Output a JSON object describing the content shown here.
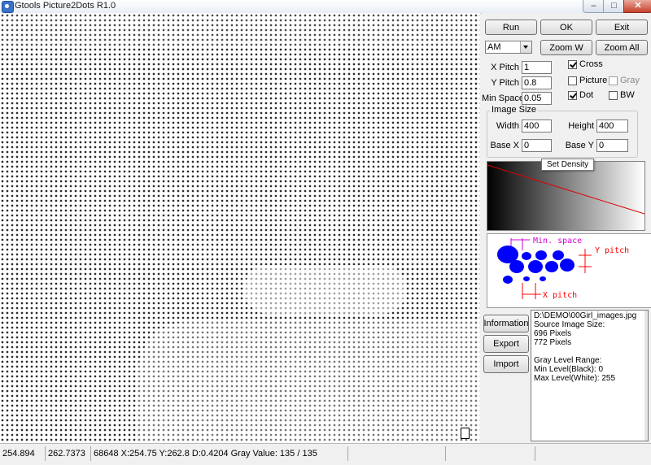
{
  "window": {
    "title": "Gtools Picture2Dots R1.0",
    "min_glyph": "–",
    "max_glyph": "□",
    "close_glyph": "✕"
  },
  "toolbar": {
    "run_label": "Run",
    "ok_label": "OK",
    "exit_label": "Exit",
    "mode_value": "AM",
    "zoom_w_label": "Zoom W",
    "zoom_all_label": "Zoom All"
  },
  "params": {
    "x_pitch_label": "X Pitch",
    "x_pitch_value": "1",
    "y_pitch_label": "Y Pitch",
    "y_pitch_value": "0.8",
    "min_space_label": "Min Space",
    "min_space_value": "0.05"
  },
  "options": {
    "cross_label": "Cross",
    "cross_checked": true,
    "picture_label": "Picture",
    "picture_checked": false,
    "gray_label": "Gray",
    "gray_checked": false,
    "dot_label": "Dot",
    "dot_checked": true,
    "bw_label": "BW",
    "bw_checked": false
  },
  "image_size": {
    "group_title": "Image Size",
    "width_label": "Width",
    "width_value": "400",
    "height_label": "Height",
    "height_value": "400",
    "base_x_label": "Base X",
    "base_x_value": "0",
    "base_y_label": "Base Y",
    "base_y_value": "0"
  },
  "density": {
    "tooltip": "Set Density"
  },
  "diagram": {
    "min_space_label": "Min. space",
    "y_pitch_label": "Y pitch",
    "x_pitch_label": "X pitch"
  },
  "actions": {
    "information_label": "Information",
    "export_label": "Export",
    "import_label": "Import"
  },
  "info": {
    "lines": [
      "D:\\DEMO\\00Girl_images.jpg",
      "Source Image Size:",
      "696 Pixels",
      "772 Pixels",
      "",
      "Gray Level Range:",
      "Min Level(Black): 0",
      "Max Level(White): 255"
    ]
  },
  "status": {
    "x": "254.894",
    "y": "262.7373",
    "detail": "68648 X:254.75 Y:262.8 D:0.4204 Gray Value: 135 / 135"
  },
  "colors": {
    "diagram_blue": "#0000ff",
    "diagram_magenta": "#d000d0",
    "diagram_red": "#ff0000"
  }
}
